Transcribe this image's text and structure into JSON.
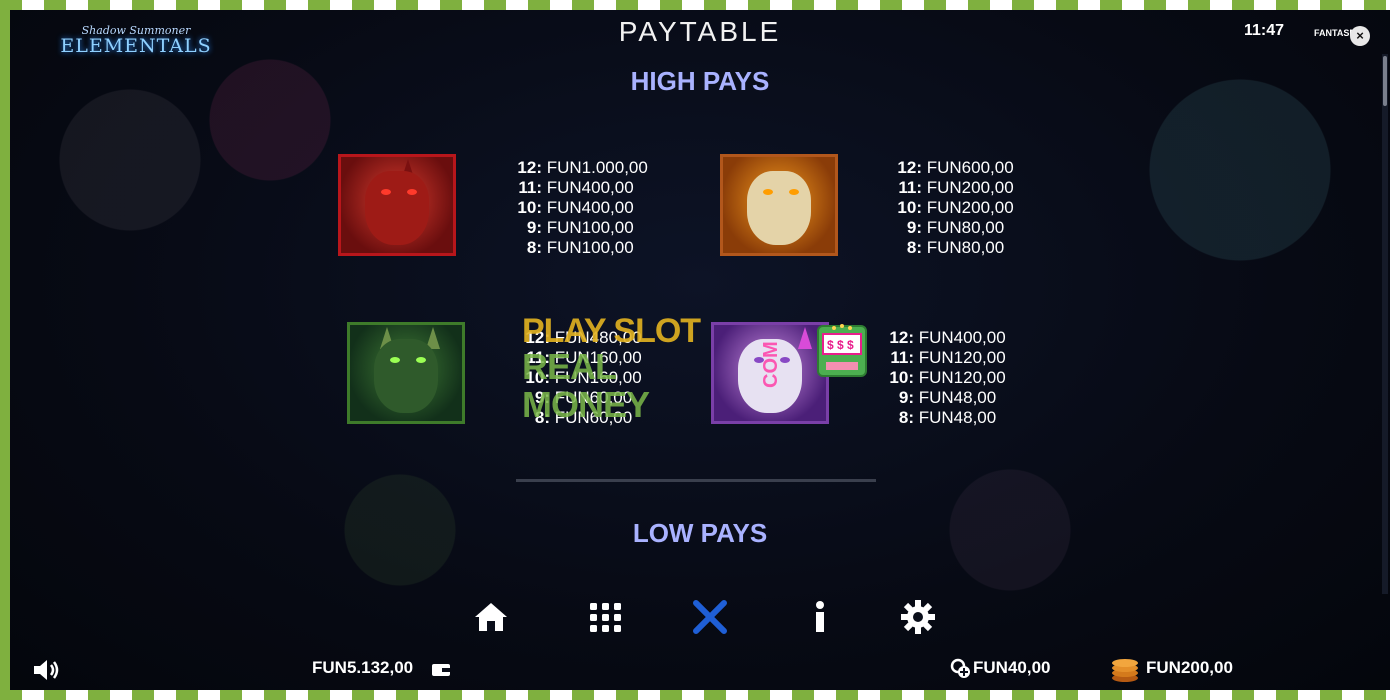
{
  "header": {
    "logo_top": "Shadow Summoner",
    "logo_bottom": "ELEMENTALS",
    "title": "PAYTABLE",
    "clock": "11:47",
    "brand": "FANTASMA"
  },
  "sections": {
    "high": "HIGH PAYS",
    "low": "LOW PAYS"
  },
  "symbols": [
    {
      "name": "red-demon",
      "pays": [
        {
          "k": "12:",
          "v": "FUN1.000,00"
        },
        {
          "k": "11:",
          "v": "FUN400,00"
        },
        {
          "k": "10:",
          "v": "FUN400,00"
        },
        {
          "k": "9:",
          "v": "FUN100,00"
        },
        {
          "k": "8:",
          "v": "FUN100,00"
        }
      ]
    },
    {
      "name": "orange-skull",
      "pays": [
        {
          "k": "12:",
          "v": "FUN600,00"
        },
        {
          "k": "11:",
          "v": "FUN200,00"
        },
        {
          "k": "10:",
          "v": "FUN200,00"
        },
        {
          "k": "9:",
          "v": "FUN80,00"
        },
        {
          "k": "8:",
          "v": "FUN80,00"
        }
      ]
    },
    {
      "name": "green-orc",
      "pays": [
        {
          "k": "12:",
          "v": "FUN480,00"
        },
        {
          "k": "11:",
          "v": "FUN160,00"
        },
        {
          "k": "10:",
          "v": "FUN160,00"
        },
        {
          "k": "9:",
          "v": "FUN60,00"
        },
        {
          "k": "8:",
          "v": "FUN60,00"
        }
      ]
    },
    {
      "name": "purple-elf",
      "pays": [
        {
          "k": "12:",
          "v": "FUN400,00"
        },
        {
          "k": "11:",
          "v": "FUN120,00"
        },
        {
          "k": "10:",
          "v": "FUN120,00"
        },
        {
          "k": "9:",
          "v": "FUN48,00"
        },
        {
          "k": "8:",
          "v": "FUN48,00"
        }
      ]
    }
  ],
  "watermark": {
    "line1": "PLAY SLOT",
    "line2": "REAL MONEY",
    "com": "COM"
  },
  "footer": {
    "balance": "FUN5.132,00",
    "bet": "FUN40,00",
    "win": "FUN200,00"
  },
  "icons": [
    "home-icon",
    "grid-icon",
    "close-icon",
    "info-icon",
    "settings-icon",
    "speaker-icon",
    "wallet-icon",
    "bet-icon",
    "coins-icon"
  ],
  "colors": {
    "section_heading": "#a9b2ff",
    "close_x": "#1f5fd6",
    "frame_green": "#7fb03f"
  }
}
